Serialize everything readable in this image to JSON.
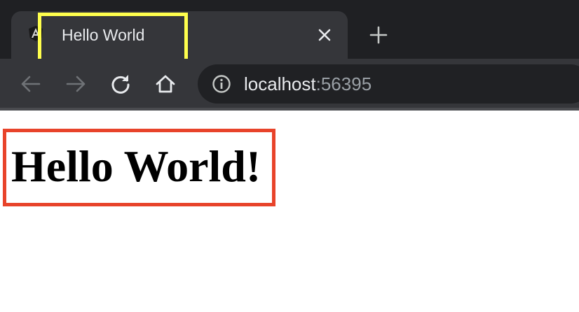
{
  "browser": {
    "tab": {
      "title": "Hello World",
      "favicon_icon": "angular-logo-icon",
      "close_icon": "close-icon"
    },
    "new_tab_icon": "plus-icon",
    "nav": {
      "back_icon": "arrow-left-icon",
      "forward_icon": "arrow-right-icon",
      "reload_icon": "reload-icon",
      "home_icon": "home-icon"
    },
    "address_bar": {
      "info_icon": "info-icon",
      "host": "localhost",
      "port": ":56395"
    }
  },
  "page": {
    "heading": "Hello World!"
  },
  "annotations": {
    "yellow_box_color": "#ffff4d",
    "red_box_color": "#e8432a"
  },
  "colors": {
    "tabstrip": "#1f2023",
    "toolbar": "#35363a",
    "omnibox": "#202124"
  }
}
